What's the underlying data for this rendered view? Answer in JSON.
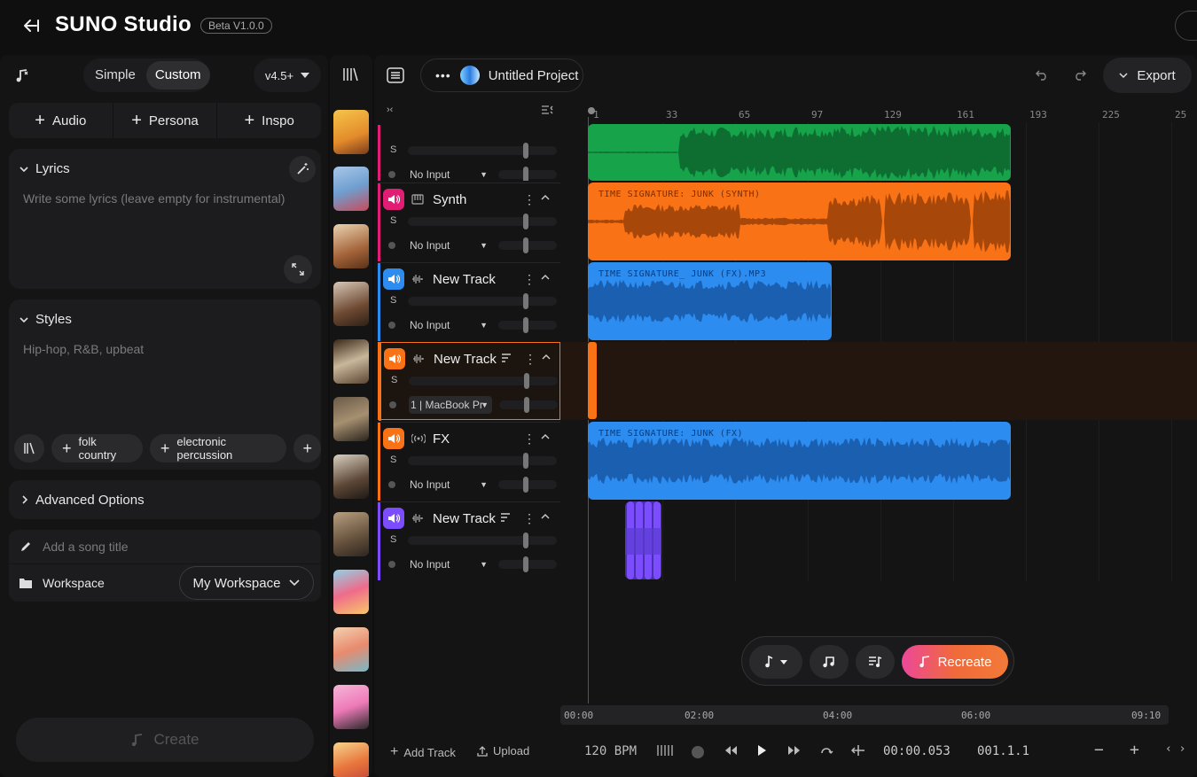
{
  "header": {
    "title": "SUNO Studio",
    "beta_badge": "Beta V1.0.0"
  },
  "left_panel": {
    "mode_simple": "Simple",
    "mode_custom": "Custom",
    "version": "v4.5+",
    "sources": [
      "Audio",
      "Persona",
      "Inspo"
    ],
    "lyrics": {
      "title": "Lyrics",
      "placeholder": "Write some lyrics (leave empty for instrumental)"
    },
    "styles": {
      "title": "Styles",
      "placeholder": "Hip-hop, R&B, upbeat",
      "chips": [
        "folk country",
        "electronic percussion"
      ]
    },
    "advanced_options": "Advanced Options",
    "song_title_placeholder": "Add a song title",
    "workspace_label": "Workspace",
    "workspace_value": "My Workspace",
    "create_button": "Create"
  },
  "project": {
    "name": "Untitled Project",
    "export_label": "Export"
  },
  "ruler": [
    "1",
    "33",
    "65",
    "97",
    "129",
    "161",
    "193",
    "225",
    "25"
  ],
  "tracks": [
    {
      "name": "",
      "input": "No Input",
      "color": "#e11d74"
    },
    {
      "name": "Synth",
      "input": "No Input",
      "color": "#e11d74"
    },
    {
      "name": "New Track",
      "input": "No Input",
      "color": "#2d8cf0"
    },
    {
      "name": "New Track",
      "input": "1 | MacBook Pr",
      "color": "#f97316"
    },
    {
      "name": "FX",
      "input": "No Input",
      "color": "#f97316"
    },
    {
      "name": "New Track",
      "input": "No Input",
      "color": "#7c4dff"
    }
  ],
  "solo_label": "S",
  "clips": {
    "synth": "TIME SIGNATURE: JUNK (SYNTH)",
    "fx_mp3": "TIME SIGNATURE_ JUNK (FX).MP3",
    "fx": "TIME SIGNATURE: JUNK (FX)"
  },
  "ai_bar": {
    "recreate_label": "Recreate"
  },
  "timeline": [
    "00:00",
    "02:00",
    "04:00",
    "06:00",
    "09:10"
  ],
  "transport": {
    "add_track": "Add Track",
    "upload": "Upload",
    "bpm": "120 BPM",
    "time": "00:00.053",
    "position": "001.1.1"
  },
  "colors": {
    "green_clip": "#16a34a",
    "orange_clip": "#f97316",
    "blue_clip": "#2d8cf0",
    "purple_clip": "#7c4dff",
    "accent_recreate": "#ec4899"
  }
}
